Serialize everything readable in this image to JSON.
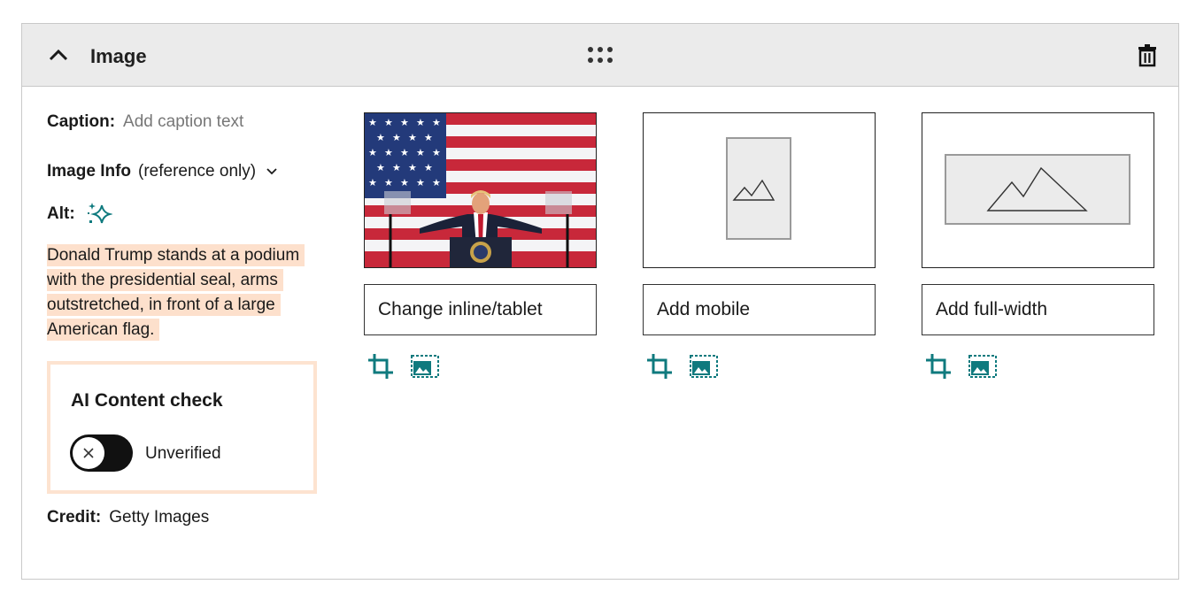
{
  "header": {
    "title": "Image",
    "collapse_icon": "chevron-up-icon",
    "drag_icon": "drag-dots-icon",
    "delete_icon": "trash-icon"
  },
  "fields": {
    "caption_label": "Caption:",
    "caption_placeholder": "Add caption text",
    "image_info_label": "Image Info",
    "image_info_note": "(reference only)",
    "alt_label": "Alt:",
    "alt_text": "Donald Trump stands at a podium with the presidential seal, arms outstretched, in front of a large American flag.",
    "credit_label": "Credit:",
    "credit_value": "Getty Images"
  },
  "ai_check": {
    "title": "AI Content check",
    "status": "Unverified",
    "enabled": false
  },
  "variants": [
    {
      "button": "Change inline/tablet",
      "preview": "photo"
    },
    {
      "button": "Add mobile",
      "preview": "portrait-placeholder"
    },
    {
      "button": "Add full-width",
      "preview": "landscape-placeholder"
    }
  ],
  "colors": {
    "accent_teal": "#0f7a7e",
    "highlight": "#fde0cc",
    "header_bg": "#ebebeb"
  }
}
